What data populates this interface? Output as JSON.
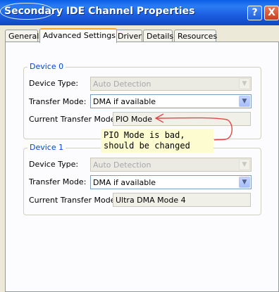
{
  "window": {
    "title": "Secondary IDE Channel Properties",
    "help_glyph": "?",
    "close_glyph": "X"
  },
  "tabs": [
    {
      "label": "General"
    },
    {
      "label": "Advanced Settings",
      "active": true
    },
    {
      "label": "Driver"
    },
    {
      "label": "Details"
    },
    {
      "label": "Resources"
    }
  ],
  "device0": {
    "title": "Device 0",
    "device_type_label": "Device Type:",
    "device_type_value": "Auto Detection",
    "transfer_mode_label": "Transfer Mode:",
    "transfer_mode_value": "DMA if available",
    "current_mode_label": "Current Transfer Mode:",
    "current_mode_value": "PIO Mode"
  },
  "device1": {
    "title": "Device 1",
    "device_type_label": "Device Type:",
    "device_type_value": "Auto Detection",
    "transfer_mode_label": "Transfer Mode:",
    "transfer_mode_value": "DMA if available",
    "current_mode_label": "Current Transfer Mode:",
    "current_mode_value": "Ultra DMA Mode 4"
  },
  "annotation": {
    "line1": "PIO Mode is bad,",
    "line2": "should be changed",
    "color": "#e04848"
  },
  "icons": {
    "dropdown": "chevron-down-icon"
  }
}
